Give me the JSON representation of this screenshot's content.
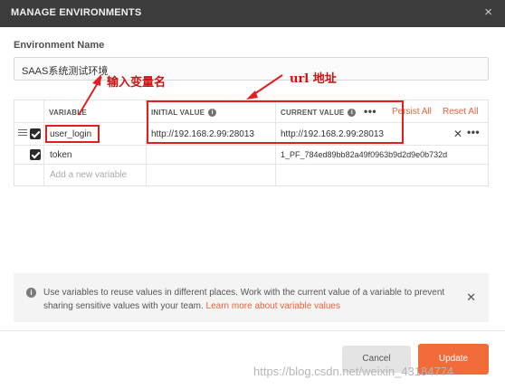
{
  "dialog": {
    "title": "MANAGE ENVIRONMENTS",
    "close_glyph": "×"
  },
  "env_name": {
    "label": "Environment Name",
    "value": "SAAS系统测试环境"
  },
  "table": {
    "headers": {
      "variable": "VARIABLE",
      "initial": "INITIAL VALUE",
      "current": "CURRENT VALUE"
    },
    "persist_all": "Persist All",
    "reset_all": "Reset All",
    "more_glyph": "•••",
    "rows": [
      {
        "checked": true,
        "variable": "user_login",
        "initial": "http://192.168.2.99:28013",
        "current": "http://192.168.2.99:28013"
      },
      {
        "checked": true,
        "variable": "token",
        "initial": "",
        "current": "1_PF_784ed89bb82a49f0963b9d2d9e0b732d"
      }
    ],
    "new_row_placeholder": "Add a new variable",
    "row_delete_glyph": "✕"
  },
  "annotations": {
    "variable_note": "输入变量名",
    "url_note": "url 地址"
  },
  "info": {
    "text": "Use variables to reuse values in different places. Work with the current value of a variable to prevent sharing sensitive values with your team.",
    "link": "Learn more about variable values",
    "close_glyph": "✕"
  },
  "buttons": {
    "cancel": "Cancel",
    "update": "Update"
  },
  "watermark": "https://blog.csdn.net/weixin_43184774",
  "colors": {
    "accent": "#f26b3a",
    "link": "#e8633c",
    "annotation": "#e02020",
    "titlebar": "#3c3c3c"
  }
}
